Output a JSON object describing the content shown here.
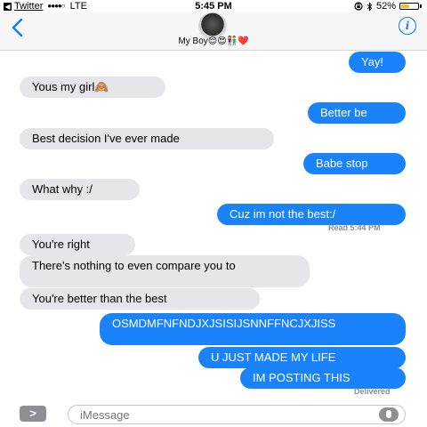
{
  "status_bar": {
    "back_app_glyph": "◀",
    "back_app": "Twitter",
    "signal": "●●●●○",
    "carrier": "LTE",
    "time": "5:45 PM",
    "icons": [
      "orientation-lock-icon",
      "bluetooth-icon"
    ],
    "battery_text": "52%",
    "battery_level": 0.52,
    "battery_color": "#f4c20d"
  },
  "header": {
    "back_icon": "chevron-left-icon",
    "contact_name": "My Boy😌😍👫❤️",
    "info_icon_label": "i",
    "accent": "#147efb"
  },
  "messages": [
    {
      "side": "out",
      "text": "Yay!"
    },
    {
      "side": "in",
      "text": "Yous my girl🙈"
    },
    {
      "side": "out",
      "text": "Better be"
    },
    {
      "side": "in",
      "text": "Best decision I've ever made"
    },
    {
      "side": "out",
      "text": "Babe stop"
    },
    {
      "side": "in",
      "text": "What why :/"
    },
    {
      "side": "out",
      "text": "Cuz im not the best:/"
    },
    {
      "side": "in",
      "text": "You're right"
    },
    {
      "side": "in",
      "text": "There's nothing to even compare you to"
    },
    {
      "side": "in",
      "text": "You're better than the best"
    },
    {
      "side": "out",
      "text": "OSMDMFNFNDJXJSISIJSNNFFNCJXJISS"
    },
    {
      "side": "out",
      "text": "U JUST MADE MY LIFE"
    },
    {
      "side": "out",
      "text": "IM POSTING THIS"
    }
  ],
  "receipts": {
    "read": "Read 5:44 PM",
    "delivered": "Delivered"
  },
  "input_bar": {
    "expand_label": ">",
    "placeholder": "iMessage",
    "mic_icon": "microphone-icon"
  },
  "colors": {
    "incoming_bubble": "#e5e5ea",
    "outgoing_bubble": "#1a82fb",
    "receipt_text": "#8e8e93"
  }
}
